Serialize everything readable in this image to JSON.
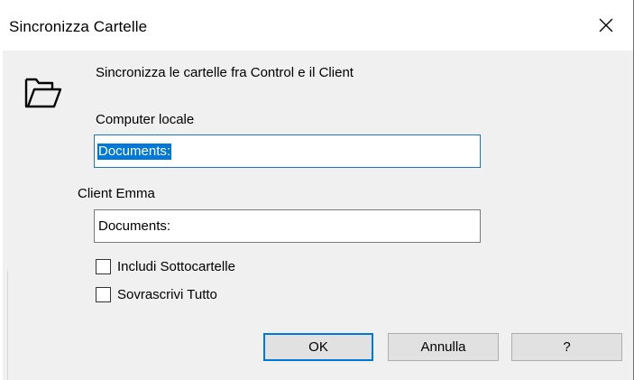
{
  "window": {
    "title": "Sincronizza Cartelle",
    "close_glyph": "✕"
  },
  "dialog": {
    "description": "Sincronizza le cartelle fra Control e il Client",
    "icon": "folder-open-icon",
    "local_label": "Computer locale",
    "local_value": "Documents:",
    "client_label": "Client Emma",
    "client_value": "Documents:"
  },
  "options": [
    {
      "label": "Includi Sottocartelle",
      "checked": false
    },
    {
      "label": "Sovrascrivi Tutto",
      "checked": false
    }
  ],
  "buttons": {
    "ok": "OK",
    "cancel": "Annulla",
    "help": "?"
  },
  "colors": {
    "accent": "#0078d7",
    "dialog_bg": "#f0f0f0",
    "button_bg": "#e1e1e1"
  }
}
